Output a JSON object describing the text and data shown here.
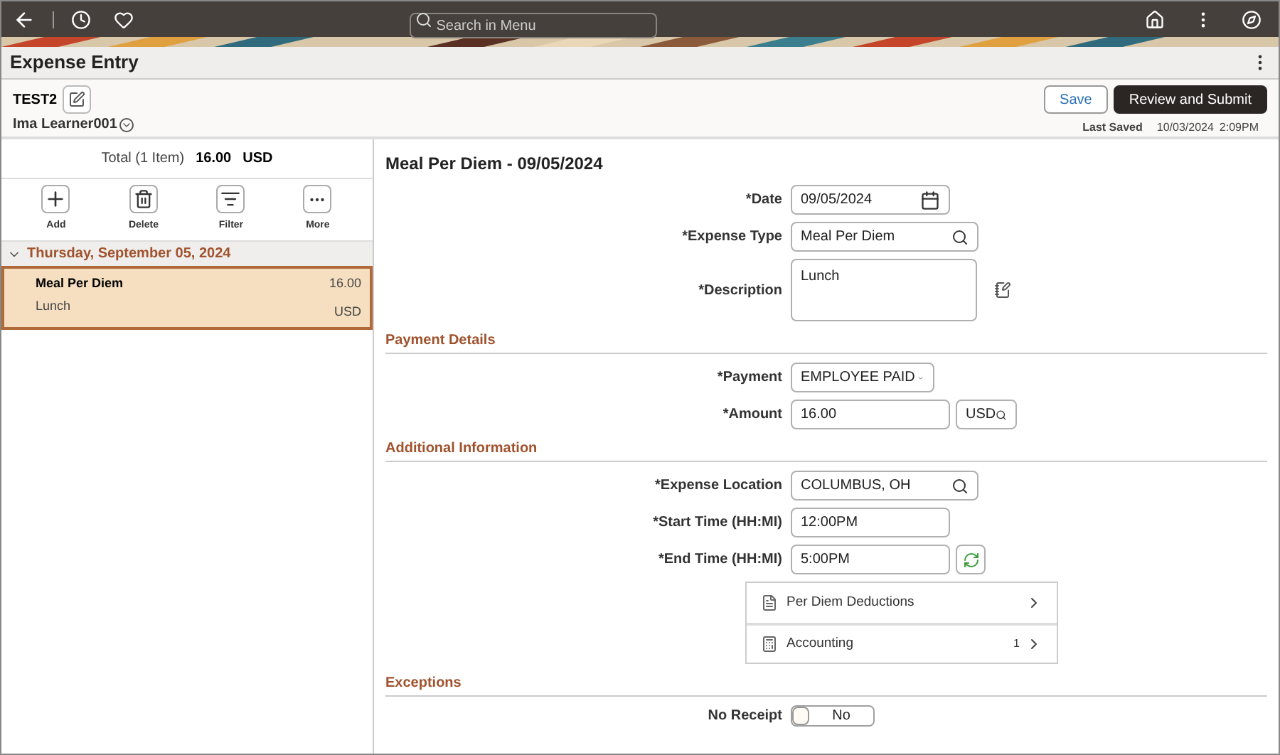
{
  "topbar": {
    "search": {
      "placeholder": "Search in Menu"
    }
  },
  "page": {
    "title": "Expense Entry"
  },
  "header": {
    "report_name": "TEST2",
    "employee": "Ima Learner001",
    "buttons": [
      {
        "label": "Save",
        "kind": "secondary"
      },
      {
        "label": "Review and Submit",
        "kind": "primary"
      }
    ],
    "last_saved_label": "Last Saved",
    "last_saved_date": "10/03/2024",
    "last_saved_time": "2:09PM"
  },
  "left_panel": {
    "total_label": "Total (1 Item)",
    "total_amount": "16.00",
    "total_currency": "USD",
    "actions": [
      {
        "label": "Add",
        "kind": "add"
      },
      {
        "label": "Delete",
        "kind": "delete"
      },
      {
        "label": "Filter",
        "kind": "filter"
      },
      {
        "label": "More",
        "kind": "more"
      }
    ],
    "groups": [
      {
        "date": "Thursday, September 05, 2024",
        "expanded": true,
        "items": [
          {
            "title": "Meal Per Diem",
            "description": "Lunch",
            "amount": "16.00",
            "currency": "USD",
            "selected": true
          }
        ]
      }
    ]
  },
  "detail": {
    "title": "Meal Per Diem - 09/05/2024",
    "sections": [
      {
        "fields": [
          {
            "label": "*Date",
            "value": "09/05/2024",
            "kind": "date"
          },
          {
            "label": "*Expense Type",
            "value": "Meal Per Diem",
            "kind": "search"
          },
          {
            "label": "*Description",
            "value": "Lunch",
            "kind": "textarea"
          }
        ]
      },
      {
        "heading": "Payment Details",
        "fields": [
          {
            "label": "*Payment",
            "value": "EMPLOYEE PAID",
            "kind": "select"
          },
          {
            "label": "*Amount",
            "value": "16.00",
            "currency": "USD",
            "kind": "amount"
          }
        ]
      },
      {
        "heading": "Additional Information",
        "fields": [
          {
            "label": "*Expense Location",
            "value": "COLUMBUS, OH",
            "kind": "search"
          },
          {
            "label": "*Start Time (HH:MI)",
            "value": "12:00PM",
            "kind": "text"
          },
          {
            "label": "*End Time (HH:MI)",
            "value": "5:00PM",
            "kind": "refresh"
          }
        ],
        "links": [
          {
            "label": "Per Diem Deductions",
            "kind": "list"
          },
          {
            "label": "Accounting",
            "count": "1",
            "kind": "accounting"
          }
        ]
      },
      {
        "heading": "Exceptions",
        "fields": [
          {
            "label": "No Receipt",
            "value": "No",
            "on": false,
            "kind": "toggle"
          }
        ]
      }
    ]
  }
}
